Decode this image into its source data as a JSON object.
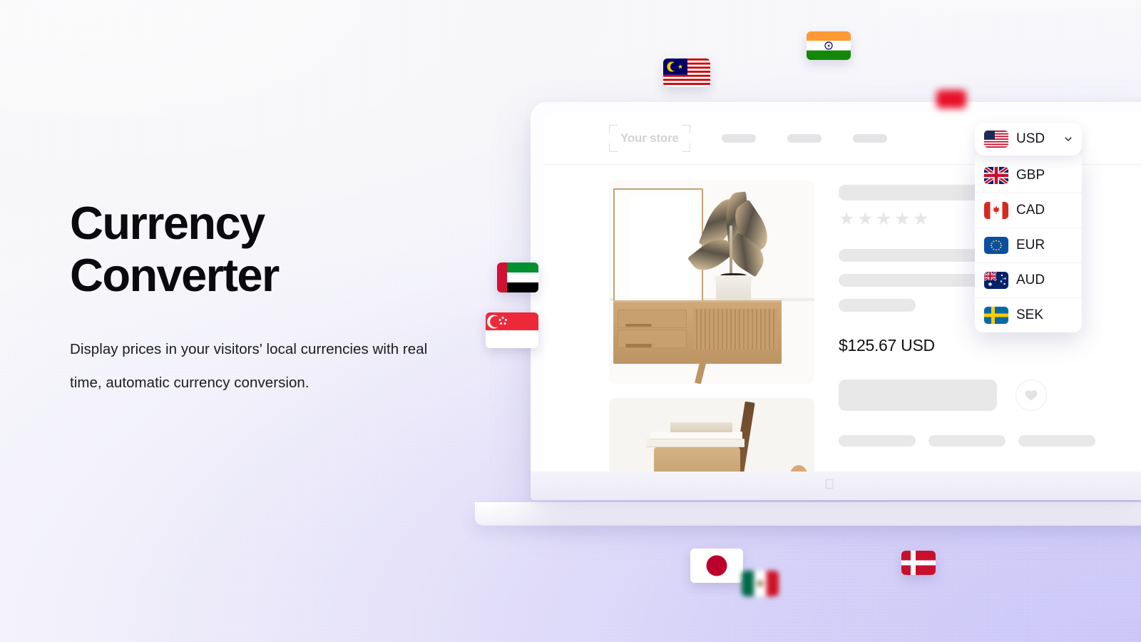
{
  "background": {
    "gradient_from": "#fbfbfc",
    "gradient_to": "#c4bef6"
  },
  "hero": {
    "headline": "Currency\nConverter",
    "subcopy": "Display prices in your visitors' local currencies with real time, automatic currency conversion.",
    "headline_color": "#0b0b0f"
  },
  "storefront": {
    "logo_placeholder": "Your store",
    "nav_items": [
      "",
      "",
      ""
    ],
    "product": {
      "price": "$125.67 USD",
      "rating_stars": 5,
      "primary_image_alt": "wooden sideboard with potted rubber plant",
      "secondary_image_alt": "stack of books on a wooden stool",
      "wishlist_icon": "heart-icon"
    },
    "device": {
      "brand_logo": "apple-logo"
    }
  },
  "currency_widget": {
    "selected": {
      "code": "USD",
      "flag": "us-flag"
    },
    "chevron_icon": "chevron-down-icon",
    "options": [
      {
        "code": "GBP",
        "flag": "gb-flag"
      },
      {
        "code": "CAD",
        "flag": "ca-flag"
      },
      {
        "code": "EUR",
        "flag": "eu-flag"
      },
      {
        "code": "AUD",
        "flag": "au-flag"
      },
      {
        "code": "SEK",
        "flag": "se-flag"
      }
    ]
  },
  "floating_flags": [
    {
      "name": "malaysia-flag"
    },
    {
      "name": "india-flag"
    },
    {
      "name": "blurred-red-flag"
    },
    {
      "name": "uae-flag"
    },
    {
      "name": "singapore-flag"
    },
    {
      "name": "japan-flag"
    },
    {
      "name": "mexico-flag"
    },
    {
      "name": "denmark-flag"
    }
  ]
}
